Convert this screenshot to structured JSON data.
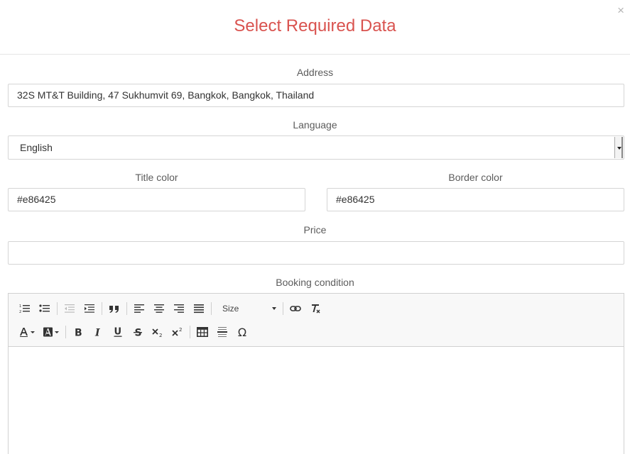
{
  "modal": {
    "title": "Select Required Data",
    "close_glyph": "×"
  },
  "form": {
    "address_label": "Address",
    "address_value": "32S MT&T Building, 47 Sukhumvit 69, Bangkok, Bangkok, Thailand",
    "language_label": "Language",
    "language_value": "English",
    "title_color_label": "Title color",
    "title_color_value": "#e86425",
    "border_color_label": "Border color",
    "border_color_value": "#e86425",
    "price_label": "Price",
    "price_value": "",
    "booking_condition_label": "Booking condition"
  },
  "toolbar": {
    "size_label": "Size",
    "omega_glyph": "Ω"
  },
  "colors": {
    "title": "#d9534f",
    "border": "#d5d5d5",
    "toolbar_bg": "#f8f8f8"
  },
  "icons": [
    "numbered-list-icon",
    "bulleted-list-icon",
    "outdent-icon",
    "indent-icon",
    "blockquote-icon",
    "align-left-icon",
    "align-center-icon",
    "align-right-icon",
    "justify-icon",
    "link-icon",
    "remove-format-icon",
    "text-color-icon",
    "background-color-icon",
    "bold-icon",
    "italic-icon",
    "underline-icon",
    "strikethrough-icon",
    "subscript-icon",
    "superscript-icon",
    "table-icon",
    "horizontal-line-icon",
    "special-character-icon"
  ]
}
